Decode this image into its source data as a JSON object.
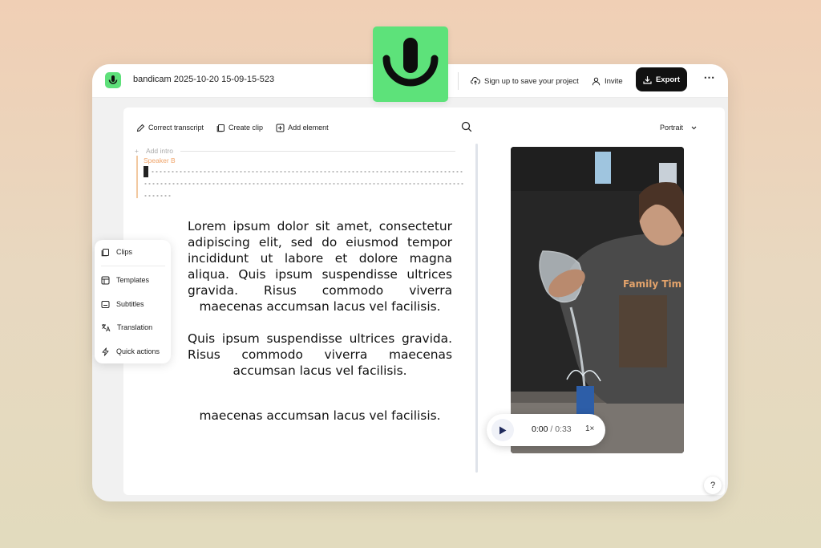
{
  "window": {
    "project_title": "bandicam 2025-10-20 15-09-15-523"
  },
  "header": {
    "signup_label": "Sign up to save your project",
    "invite_label": "Invite",
    "export_label": "Export",
    "more_label": "⋯"
  },
  "toolbar": {
    "correct_transcript": "Correct transcript",
    "create_clip": "Create clip",
    "add_element": "Add element"
  },
  "view": {
    "orientation": "Portrait"
  },
  "transcript": {
    "add_intro": "Add intro",
    "speaker": "Speaker B",
    "paragraphs": [
      "Lorem ipsum dolor sit amet, consectetur adipiscing elit, sed do eiusmod tempor incididunt ut labore et dolore magna aliqua. Quis ipsum suspendisse ultrices gravida. Risus commodo viverra maecenas accumsan lacus vel facilisis.",
      "Quis ipsum suspendisse ultrices gravida. Risus commodo viverra maecenas accumsan lacus vel facilisis.",
      "maecenas accumsan lacus vel facilisis."
    ]
  },
  "side_menu": {
    "items": [
      {
        "label": "Clips",
        "icon": "clips-icon"
      },
      {
        "label": "Templates",
        "icon": "templates-icon"
      },
      {
        "label": "Subtitles",
        "icon": "subtitles-icon"
      },
      {
        "label": "Translation",
        "icon": "translation-icon"
      },
      {
        "label": "Quick actions",
        "icon": "lightning-icon"
      }
    ]
  },
  "player": {
    "current_time": "0:00",
    "separator": " / ",
    "duration": "0:33",
    "speed": "1×"
  },
  "video": {
    "shirt_text": "Family Tim"
  },
  "help": {
    "label": "?"
  },
  "colors": {
    "brand_green": "#5de27a",
    "export_bg": "#111111",
    "speaker_orange": "#f0a46a"
  }
}
